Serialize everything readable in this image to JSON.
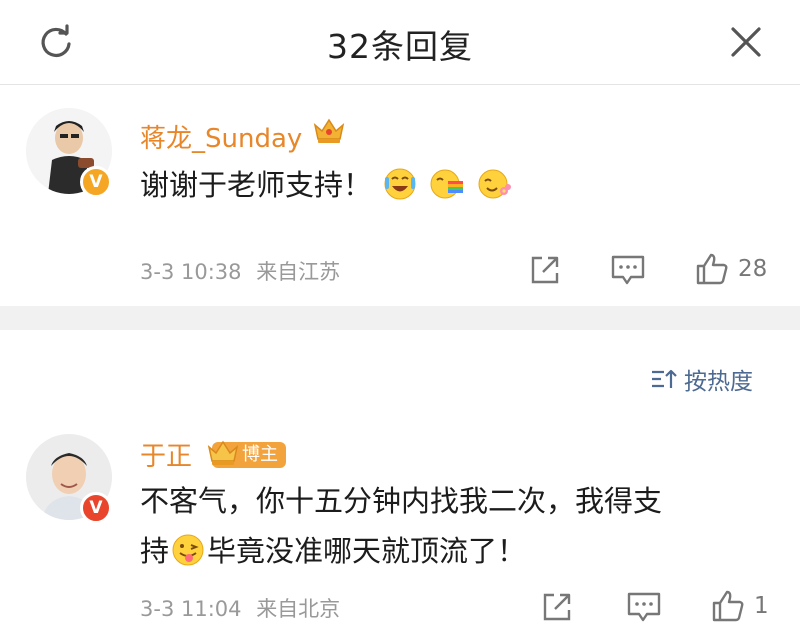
{
  "header": {
    "title": "32条回复"
  },
  "comments": [
    {
      "username": "蒋龙_Sunday",
      "text": "谢谢于老师支持！",
      "time": "3-3 10:38",
      "location": "来自江苏",
      "likes": "28",
      "verified_color": "#f5a623"
    },
    {
      "username": "于正",
      "tag": "博主",
      "text_line1": "不客气，你十五分钟内找我二次，我得支",
      "text_line2_a": "持",
      "text_line2_b": "毕竟没准哪天就顶流了！",
      "time": "3-3 11:04",
      "location": "来自北京",
      "likes": "1",
      "verified_color": "#e8452c"
    }
  ],
  "sort": {
    "label": "按热度"
  },
  "colors": {
    "username": "#e8862a",
    "link": "#4d6a92",
    "meta": "#999999"
  }
}
